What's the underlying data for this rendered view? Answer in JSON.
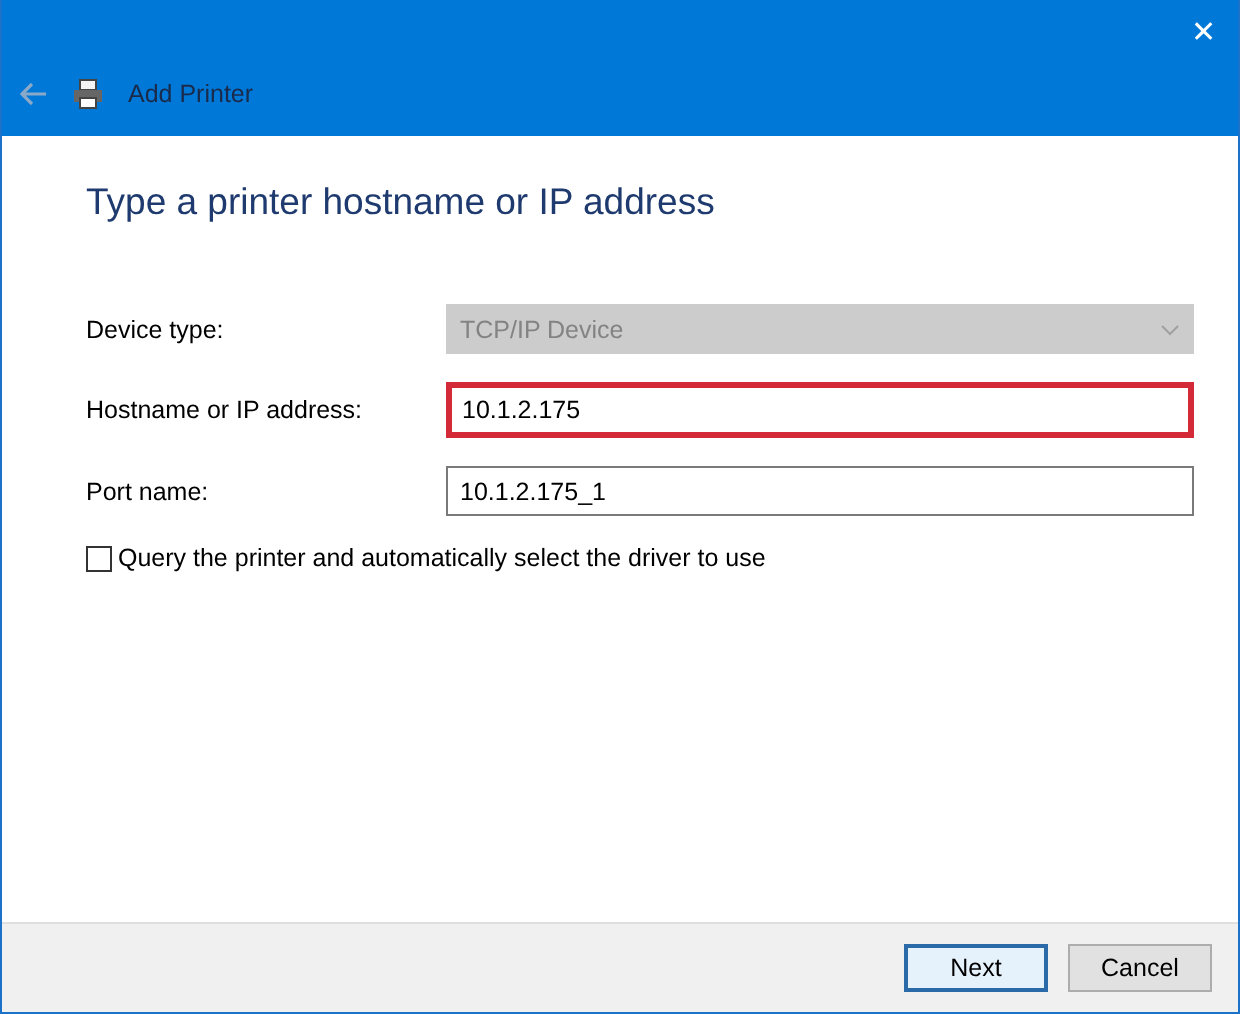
{
  "window": {
    "title": "Add Printer",
    "close": "✕"
  },
  "heading": "Type a printer hostname or IP address",
  "fields": [
    {
      "label": "Device type:",
      "kind": "dropdown",
      "value": "TCP/IP Device",
      "disabled": true,
      "highlighted": false
    },
    {
      "label": "Hostname or IP address:",
      "kind": "text",
      "value": "10.1.2.175",
      "disabled": false,
      "highlighted": true
    },
    {
      "label": "Port name:",
      "kind": "text",
      "value": "10.1.2.175_1",
      "disabled": false,
      "highlighted": false
    }
  ],
  "checkbox": {
    "label": "Query the printer and automatically select the driver to use",
    "checked": false
  },
  "buttons": [
    {
      "label": "Next",
      "default": true
    },
    {
      "label": "Cancel",
      "default": false
    }
  ]
}
